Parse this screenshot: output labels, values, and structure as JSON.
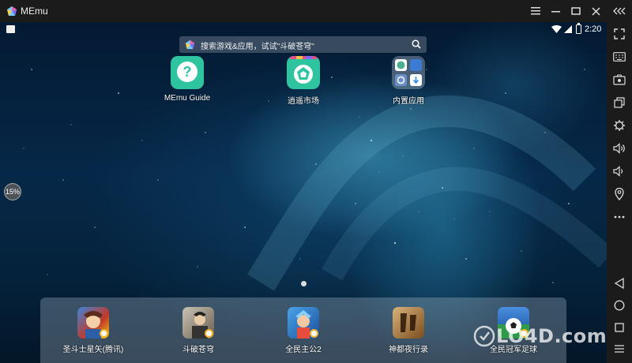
{
  "window": {
    "title": "MEmu",
    "controls": [
      "menu-icon",
      "minimize-icon",
      "maximize-icon",
      "close-icon"
    ],
    "collapse_icon": "collapse-sidebar-icon"
  },
  "status_bar": {
    "time": "2:20",
    "icons": [
      "notification-icon",
      "wifi-icon",
      "signal-icon",
      "battery-icon"
    ]
  },
  "search": {
    "placeholder": "搜索游戏&应用，试试\"斗破苍穹\""
  },
  "home_apps": [
    {
      "label": "MEmu Guide",
      "icon": "help-icon",
      "color": "#2ec4a0"
    },
    {
      "label": "逍遥市场",
      "icon": "market-icon",
      "color": "#2ec4a0"
    },
    {
      "label": "内置应用",
      "icon": "folder-icon",
      "color": "#d0dde6"
    }
  ],
  "memory_indicator": "15%",
  "dock_apps": [
    {
      "label": "圣斗士星矢(腾讯)",
      "icon": "saint-seiya-game-icon"
    },
    {
      "label": "斗破苍穹",
      "icon": "doupo-game-icon"
    },
    {
      "label": "全民主公2",
      "icon": "quanmin-game-icon"
    },
    {
      "label": "神都夜行录",
      "icon": "shendu-game-icon"
    },
    {
      "label": "全民冠军足球",
      "icon": "football-game-icon"
    }
  ],
  "sidebar_icons": [
    "fullscreen-icon",
    "keyboard-icon",
    "record-icon",
    "multi-window-icon",
    "settings-icon",
    "volume-up-icon",
    "volume-down-icon",
    "location-icon",
    "more-icon",
    "back-icon",
    "home-icon",
    "recents-icon",
    "menu-icon"
  ],
  "watermark": "LO4D.com",
  "colors": {
    "titlebar": "#1b1b1b",
    "accent": "#2ec4a0",
    "badge": "#f3b52b"
  }
}
